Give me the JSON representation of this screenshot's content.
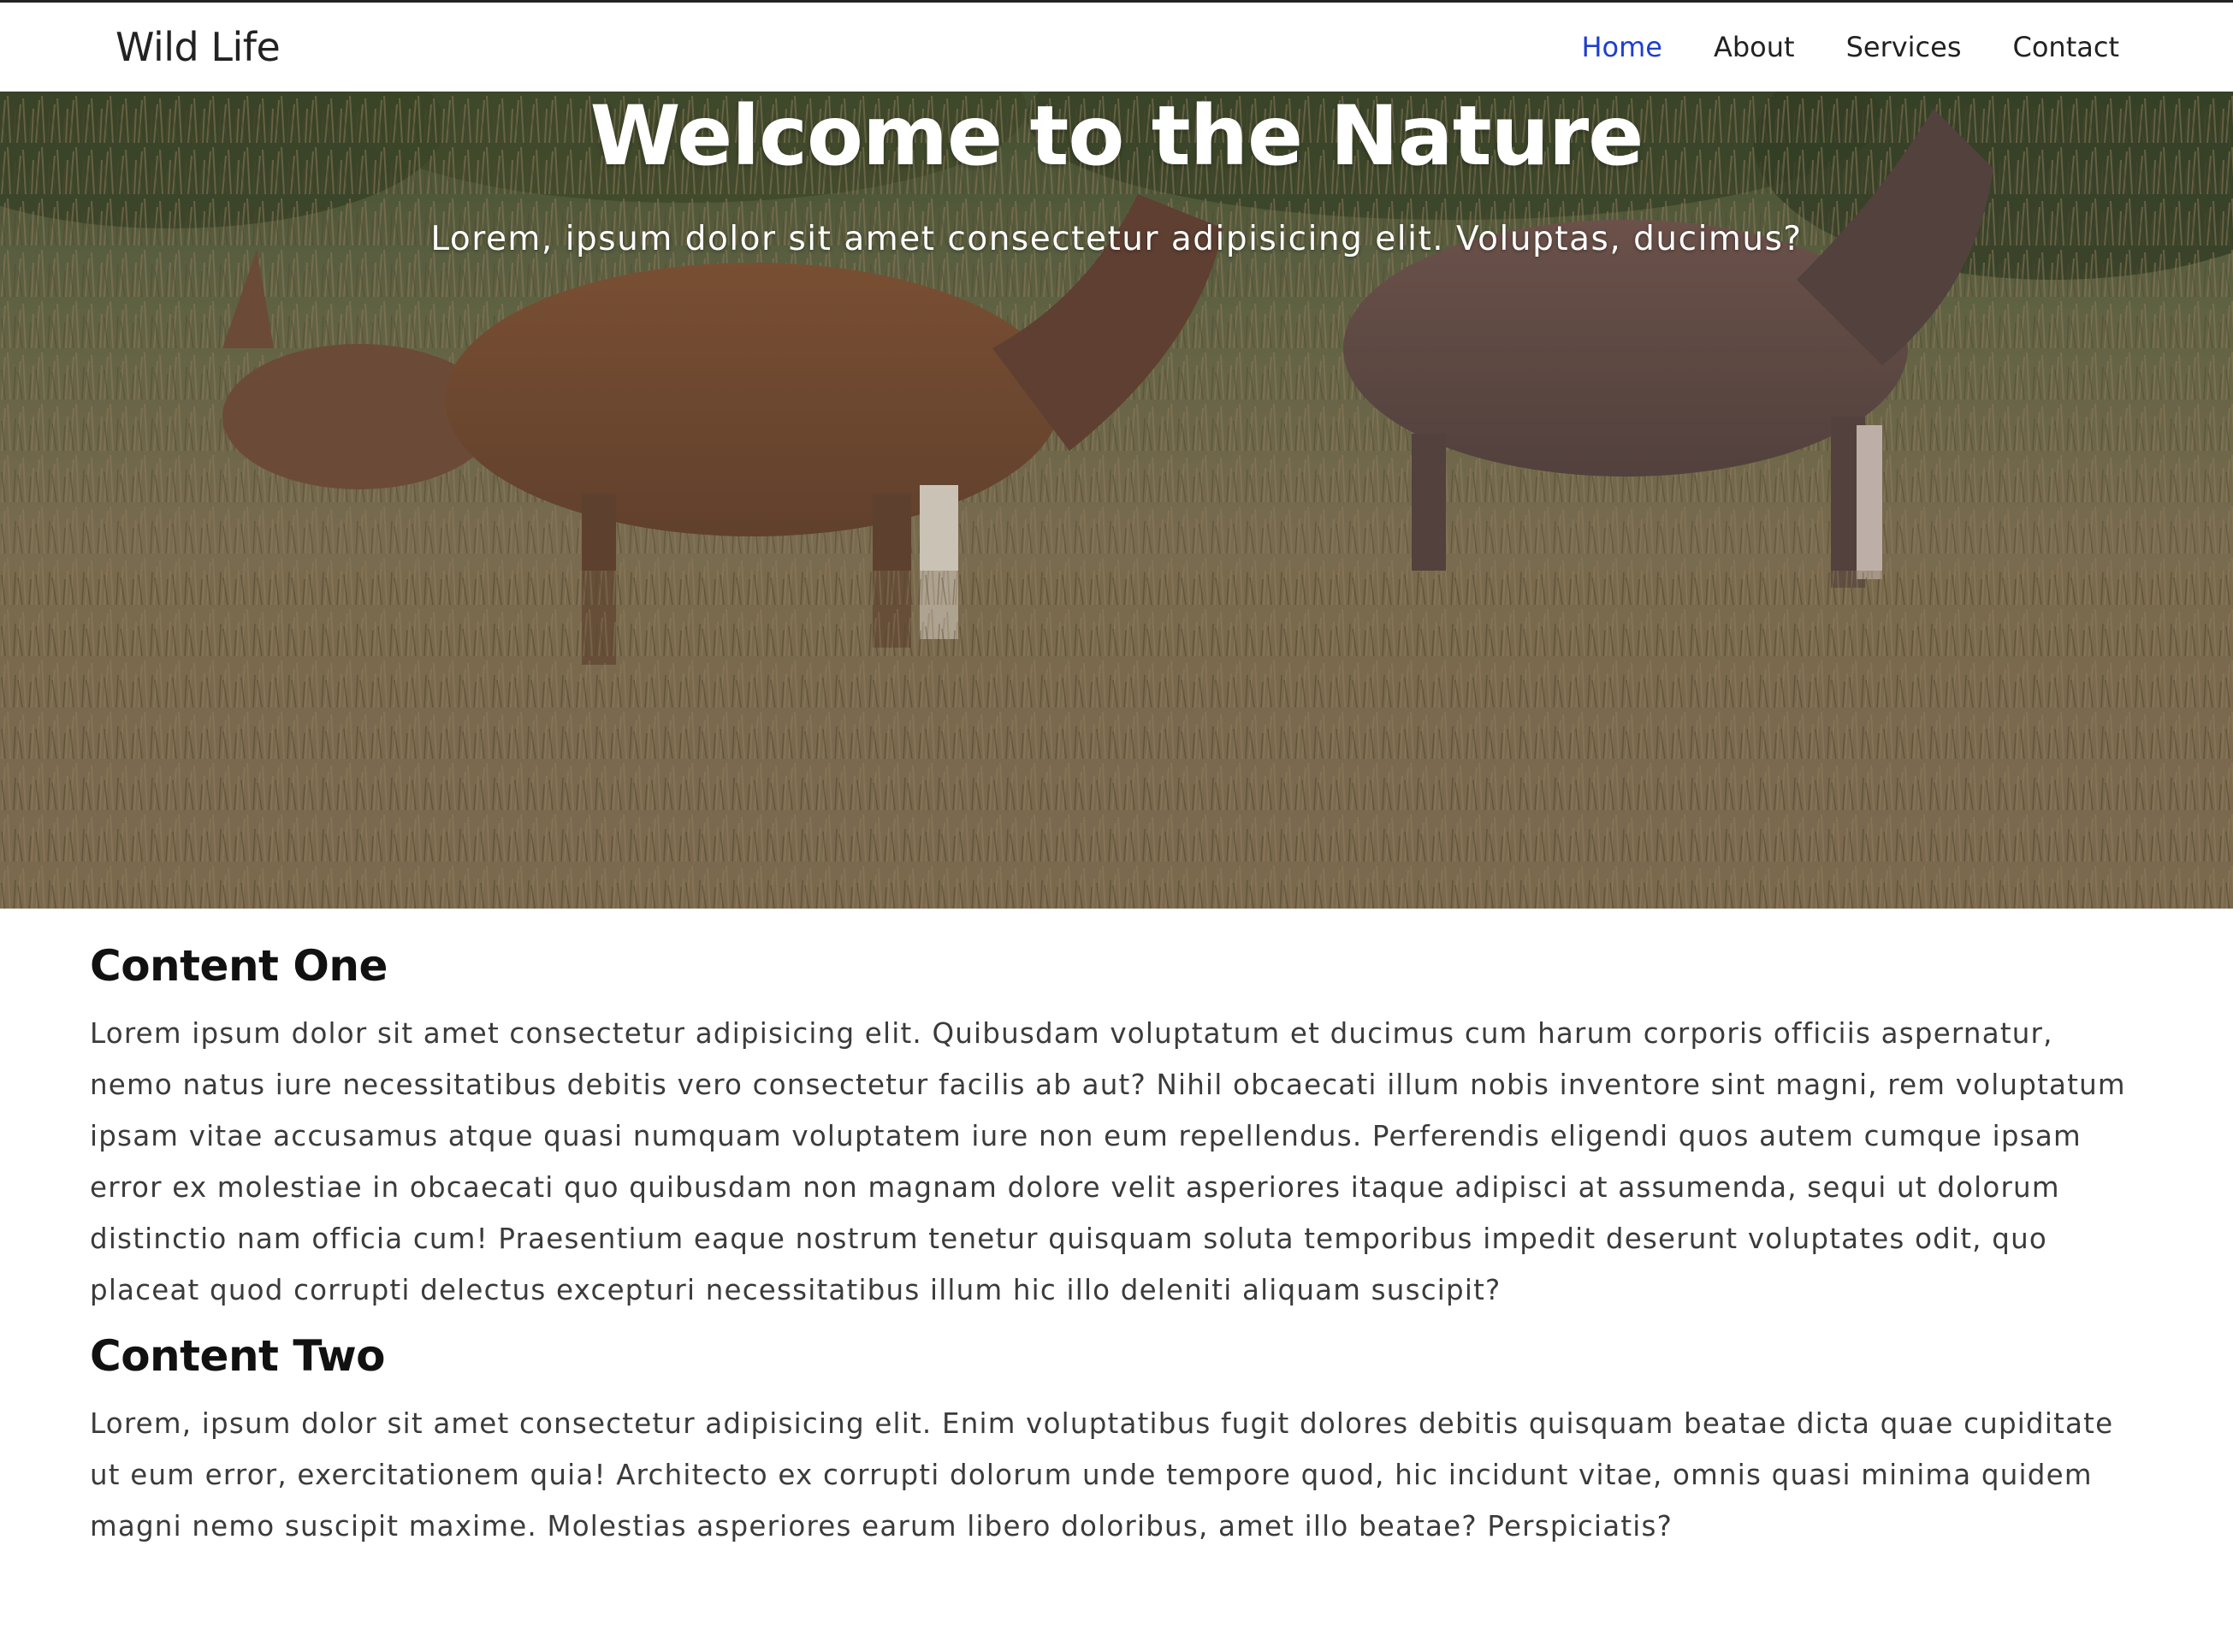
{
  "navbar": {
    "brand": "Wild Life",
    "links": [
      {
        "label": "Home",
        "active": true
      },
      {
        "label": "About",
        "active": false
      },
      {
        "label": "Services",
        "active": false
      },
      {
        "label": "Contact",
        "active": false
      }
    ],
    "active_color": "#1f3fcc"
  },
  "hero": {
    "title": "Welcome to the Nature",
    "subtitle": "Lorem, ipsum dolor sit amet consectetur adipisicing elit. Voluptas, ducimus?",
    "image_subject": "deer-grazing-in-grass"
  },
  "sections": [
    {
      "title": "Content One",
      "text": "Lorem ipsum dolor sit amet consectetur adipisicing elit. Quibusdam voluptatum et ducimus cum harum corporis officiis aspernatur, nemo natus iure necessitatibus debitis vero consectetur facilis ab aut? Nihil obcaecati illum nobis inventore sint magni, rem voluptatum ipsam vitae accusamus atque quasi numquam voluptatem iure non eum repellendus. Perferendis eligendi quos autem cumque ipsam error ex molestiae in obcaecati quo quibusdam non magnam dolore velit asperiores itaque adipisci at assumenda, sequi ut dolorum distinctio nam officia cum! Praesentium eaque nostrum tenetur quisquam soluta temporibus impedit deserunt voluptates odit, quo placeat quod corrupti delectus excepturi necessitatibus illum hic illo deleniti aliquam suscipit?"
    },
    {
      "title": "Content Two",
      "text": "Lorem, ipsum dolor sit amet consectetur adipisicing elit. Enim voluptatibus fugit dolores debitis quisquam beatae dicta quae cupiditate ut eum error, exercitationem quia! Architecto ex corrupti dolorum unde tempore quod, hic incidunt vitae, omnis quasi minima quidem magni nemo suscipit maxime. Molestias asperiores earum libero doloribus, amet illo beatae? Perspiciatis?"
    }
  ]
}
